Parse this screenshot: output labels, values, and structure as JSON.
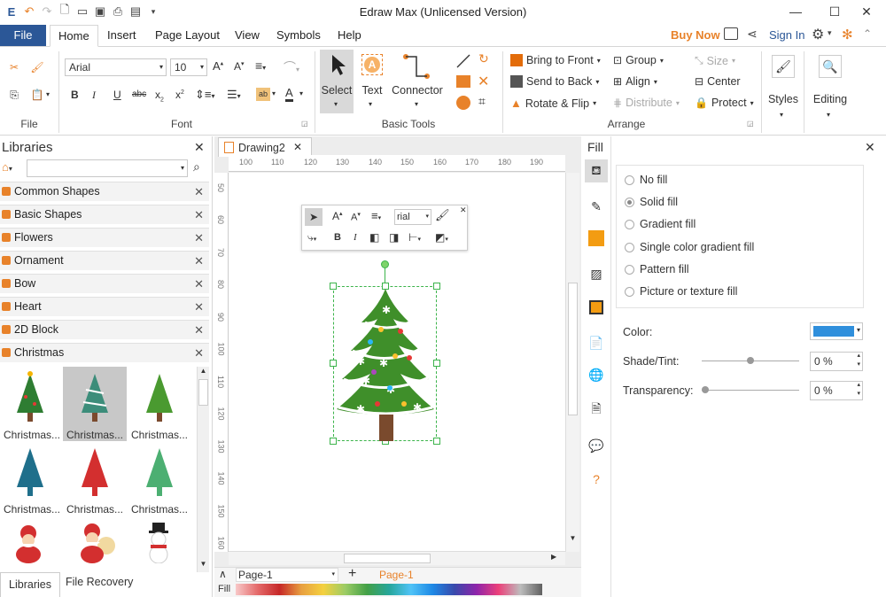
{
  "app": {
    "title": "Edraw Max (Unlicensed Version)"
  },
  "menu": {
    "file": "File",
    "tabs": [
      "Home",
      "Insert",
      "Page Layout",
      "View",
      "Symbols",
      "Help"
    ],
    "buy_now": "Buy Now",
    "sign_in": "Sign In"
  },
  "ribbon": {
    "file_group": "File",
    "font_group": "Font",
    "font_name": "Arial",
    "font_size": "10",
    "basic_tools_group": "Basic Tools",
    "select": "Select",
    "text": "Text",
    "connector": "Connector",
    "arrange_group": "Arrange",
    "bring_to_front": "Bring to Front",
    "send_to_back": "Send to Back",
    "rotate_flip": "Rotate & Flip",
    "group": "Group",
    "align": "Align",
    "distribute": "Distribute",
    "size": "Size",
    "center": "Center",
    "protect": "Protect",
    "styles": "Styles",
    "editing": "Editing"
  },
  "libraries": {
    "title": "Libraries",
    "items": [
      "Common Shapes",
      "Basic Shapes",
      "Flowers",
      "Ornament",
      "Bow",
      "Heart",
      "2D Block",
      "Christmas"
    ],
    "thumb_caption": "Christmas...",
    "tabs": [
      "Libraries",
      "File Recovery"
    ]
  },
  "document": {
    "tab": "Drawing2",
    "ruler_h": [
      "100",
      "110",
      "120",
      "130",
      "140",
      "150",
      "160",
      "170",
      "180",
      "190"
    ],
    "ruler_v": [
      "50",
      "60",
      "70",
      "80",
      "90",
      "100",
      "110",
      "120",
      "130",
      "140",
      "150",
      "160"
    ],
    "float_font": "rial",
    "page_select": "Page-1",
    "page_tab": "Page-1",
    "fill_label": "Fill"
  },
  "fill_panel": {
    "title": "Fill",
    "options": [
      "No fill",
      "Solid fill",
      "Gradient fill",
      "Single color gradient fill",
      "Pattern fill",
      "Picture or texture fill"
    ],
    "selected_option": "Solid fill",
    "color_label": "Color:",
    "color_value": "#2f8fdc",
    "shade_label": "Shade/Tint:",
    "shade_value": "0 %",
    "shade_fraction": 0.5,
    "transparency_label": "Transparency:",
    "transparency_value": "0 %",
    "transparency_fraction": 0.0
  },
  "colors": {
    "accent": "#2b5797",
    "orange": "#e8822a",
    "tree_green": "#3f8f2a",
    "trunk": "#7a4a2d"
  }
}
